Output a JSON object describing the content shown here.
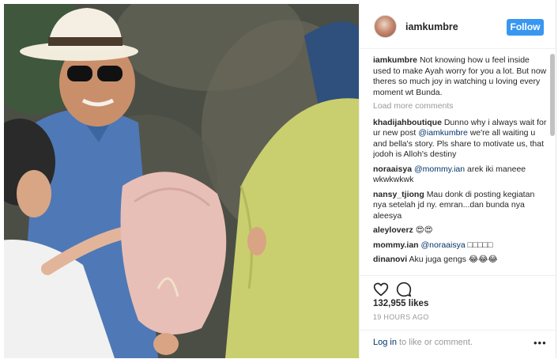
{
  "post": {
    "username": "iamkumbre",
    "follow_label": "Follow"
  },
  "caption": {
    "username": "iamkumbre",
    "text": "Not knowing how u feel inside used to make Ayah worry for you a lot. But now theres so much joy in watching u loving every moment wt Bunda."
  },
  "load_more_label": "Load more comments",
  "comments": [
    {
      "username": "khadijahboutique",
      "text_before": "Dunno why i always wait for ur new post ",
      "mention": "@iamkumbre",
      "text_after": " we're all waiting u and bella's story. Pls share to motivate us, that jodoh is Alloh's destiny"
    },
    {
      "username": "noraaisya",
      "text_before": "",
      "mention": "@mommy.ian",
      "text_after": " arek iki maneee wkwkwkwk"
    },
    {
      "username": "nansy_tjiong",
      "text_before": "Mau donk di posting kegiatan nya setelah jd ny. emran...dan bunda nya aleesya",
      "mention": "",
      "text_after": ""
    },
    {
      "username": "aleyloverz",
      "text_before": "😍😍",
      "mention": "",
      "text_after": ""
    },
    {
      "username": "mommy.ian",
      "text_before": "",
      "mention": "@noraaisya",
      "text_after": " □□□□□"
    },
    {
      "username": "dinanovi",
      "text_before": "Aku juga gengs 😂😂😂",
      "mention": "",
      "text_after": ""
    }
  ],
  "icons": {
    "heart": "heart-icon",
    "comment": "comment-icon",
    "more": "more-options-icon"
  },
  "likes_text": "132,955 likes",
  "time_text": "19 HOURS AGO",
  "footer": {
    "login_label": "Log in",
    "login_suffix": " to like or comment.",
    "more_label": "•••"
  },
  "colors": {
    "follow_button": "#3897f0",
    "link": "#003569",
    "muted": "#999999"
  }
}
